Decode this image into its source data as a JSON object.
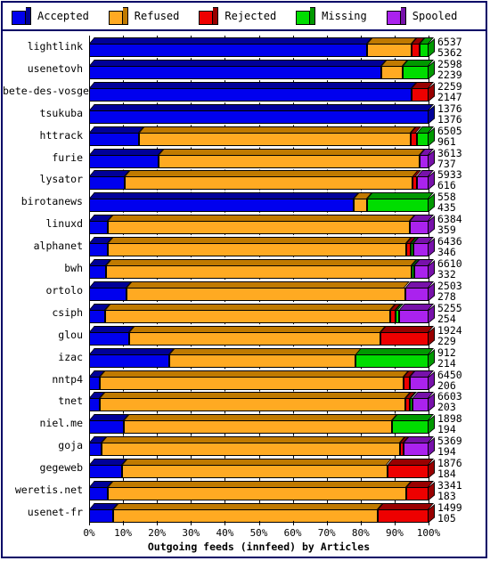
{
  "legend": {
    "items": [
      {
        "label": "Accepted",
        "color": "#0000EE",
        "side": "#000099",
        "icon": "cube-icon"
      },
      {
        "label": "Refused",
        "color": "#FFAA22",
        "side": "#C07A00",
        "icon": "cube-icon"
      },
      {
        "label": "Rejected",
        "color": "#EE0000",
        "side": "#990000",
        "icon": "cube-icon"
      },
      {
        "label": "Missing",
        "color": "#00DD00",
        "side": "#009900",
        "icon": "cube-icon"
      },
      {
        "label": "Spooled",
        "color": "#AA22EE",
        "side": "#7711AA",
        "icon": "cube-icon"
      }
    ]
  },
  "chart_data": {
    "type": "bar",
    "orientation": "horizontal-stacked-100pct",
    "title": "Outgoing feeds (innfeed) by Articles",
    "xlabel": "Outgoing feeds (innfeed) by Articles",
    "ylabel": "",
    "xlim": [
      0,
      100
    ],
    "xticks": [
      "0%",
      "10%",
      "20%",
      "30%",
      "40%",
      "50%",
      "60%",
      "70%",
      "80%",
      "90%",
      "100%"
    ],
    "grid": true,
    "legend_position": "top",
    "series_names": [
      "Accepted",
      "Refused",
      "Rejected",
      "Missing",
      "Spooled"
    ],
    "categories": [
      "lightlink",
      "usenetovh",
      "bete-des-vosges",
      "tsukuba",
      "httrack",
      "furie",
      "lysator",
      "birotanews",
      "linuxd",
      "alphanet",
      "bwh",
      "ortolo",
      "csiph",
      "glou",
      "izac",
      "nntp4",
      "tnet",
      "niel.me",
      "goja",
      "gegeweb",
      "weretis.net",
      "usenet-fr"
    ],
    "rows": [
      {
        "name": "lightlink",
        "total": 6537,
        "accepted": 5362,
        "pct": [
          82.0,
          13.0,
          2.4,
          2.6,
          0.0
        ]
      },
      {
        "name": "usenetovh",
        "total": 2598,
        "accepted": 2239,
        "pct": [
          86.2,
          6.3,
          0.0,
          7.5,
          0.0
        ]
      },
      {
        "name": "bete-des-vosges",
        "total": 2259,
        "accepted": 2147,
        "pct": [
          95.0,
          0.0,
          5.0,
          0.0,
          0.0
        ]
      },
      {
        "name": "tsukuba",
        "total": 1376,
        "accepted": 1376,
        "pct": [
          100.0,
          0.0,
          0.0,
          0.0,
          0.0
        ]
      },
      {
        "name": "httrack",
        "total": 6505,
        "accepted": 961,
        "pct": [
          14.8,
          80.0,
          1.7,
          3.5,
          0.0
        ]
      },
      {
        "name": "furie",
        "total": 3613,
        "accepted": 737,
        "pct": [
          20.4,
          77.0,
          0.0,
          0.0,
          2.6
        ]
      },
      {
        "name": "lysator",
        "total": 5933,
        "accepted": 616,
        "pct": [
          10.4,
          85.0,
          1.1,
          0.0,
          3.5
        ]
      },
      {
        "name": "birotanews",
        "total": 558,
        "accepted": 435,
        "pct": [
          78.0,
          4.0,
          0.0,
          18.0,
          0.0
        ]
      },
      {
        "name": "linuxd",
        "total": 6384,
        "accepted": 359,
        "pct": [
          5.6,
          89.0,
          0.0,
          0.0,
          5.4
        ]
      },
      {
        "name": "alphanet",
        "total": 6436,
        "accepted": 346,
        "pct": [
          5.4,
          88.0,
          1.3,
          0.9,
          4.4
        ]
      },
      {
        "name": "bwh",
        "total": 6610,
        "accepted": 332,
        "pct": [
          5.0,
          90.0,
          0.0,
          0.7,
          4.3
        ]
      },
      {
        "name": "ortolo",
        "total": 2503,
        "accepted": 278,
        "pct": [
          11.1,
          82.0,
          0.0,
          0.0,
          6.9
        ]
      },
      {
        "name": "csiph",
        "total": 5255,
        "accepted": 254,
        "pct": [
          4.8,
          84.0,
          1.6,
          0.9,
          8.7
        ]
      },
      {
        "name": "glou",
        "total": 1924,
        "accepted": 229,
        "pct": [
          11.9,
          74.0,
          14.1,
          0.0,
          0.0
        ]
      },
      {
        "name": "izac",
        "total": 912,
        "accepted": 214,
        "pct": [
          23.5,
          55.0,
          0.0,
          21.5,
          0.0
        ]
      },
      {
        "name": "nntp4",
        "total": 6450,
        "accepted": 206,
        "pct": [
          3.2,
          89.5,
          1.8,
          0.0,
          5.5
        ]
      },
      {
        "name": "tnet",
        "total": 6603,
        "accepted": 203,
        "pct": [
          3.1,
          90.0,
          1.5,
          0.6,
          4.8
        ]
      },
      {
        "name": "niel.me",
        "total": 1898,
        "accepted": 194,
        "pct": [
          10.2,
          79.0,
          0.0,
          10.8,
          0.0
        ]
      },
      {
        "name": "goja",
        "total": 5369,
        "accepted": 194,
        "pct": [
          3.6,
          88.0,
          1.1,
          0.0,
          7.3
        ]
      },
      {
        "name": "gegeweb",
        "total": 1876,
        "accepted": 184,
        "pct": [
          9.8,
          78.0,
          12.2,
          0.0,
          0.0
        ]
      },
      {
        "name": "weretis.net",
        "total": 3341,
        "accepted": 183,
        "pct": [
          5.5,
          88.0,
          6.5,
          0.0,
          0.0
        ]
      },
      {
        "name": "usenet-fr",
        "total": 1499,
        "accepted": 105,
        "pct": [
          7.0,
          78.0,
          15.0,
          0.0,
          0.0
        ]
      }
    ]
  }
}
